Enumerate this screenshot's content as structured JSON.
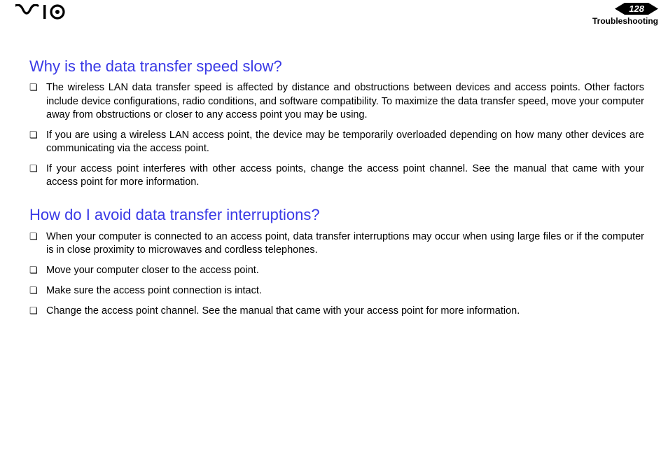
{
  "header": {
    "page_number": "128",
    "section": "Troubleshooting"
  },
  "sections": [
    {
      "heading": "Why is the data transfer speed slow?",
      "items": [
        "The wireless LAN data transfer speed is affected by distance and obstructions between devices and access points. Other factors include device configurations, radio conditions, and software compatibility. To maximize the data transfer speed, move your computer away from obstructions or closer to any access point you may be using.",
        "If you are using a wireless LAN access point, the device may be temporarily overloaded depending on how many other devices are communicating via the access point.",
        "If your access point interferes with other access points, change the access point channel. See the manual that came with your access point for more information."
      ]
    },
    {
      "heading": "How do I avoid data transfer interruptions?",
      "items": [
        "When your computer is connected to an access point, data transfer interruptions may occur when using large files or if the computer is in close proximity to microwaves and cordless telephones.",
        "Move your computer closer to the access point.",
        "Make sure the access point connection is intact.",
        "Change the access point channel. See the manual that came with your access point for more information."
      ]
    }
  ]
}
